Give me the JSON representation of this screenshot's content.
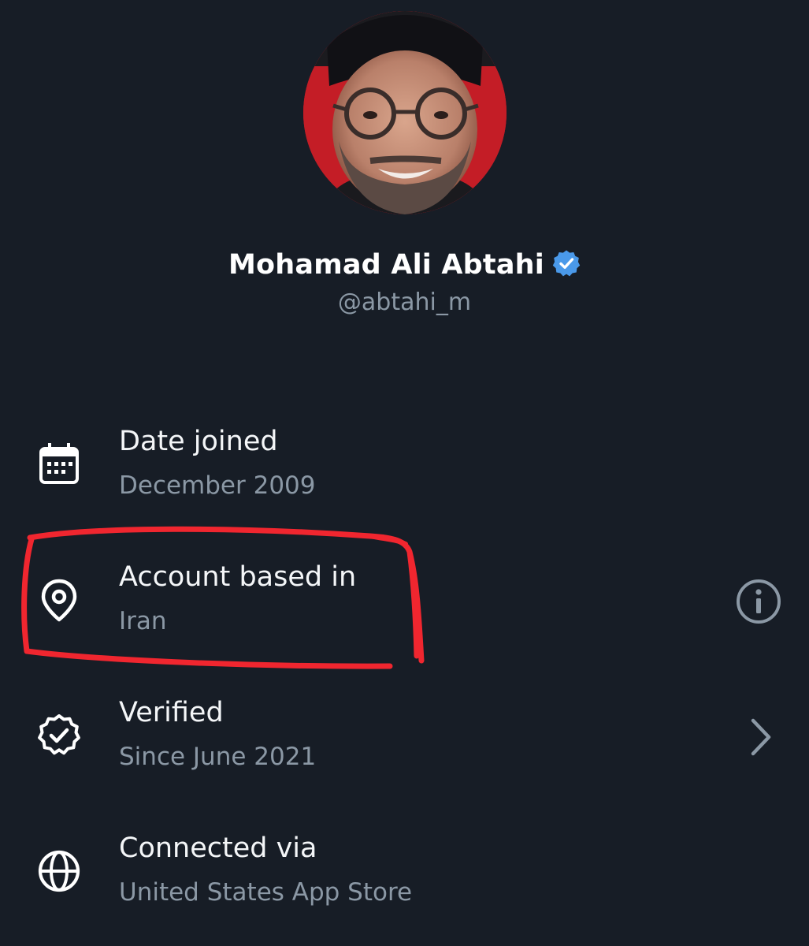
{
  "profile": {
    "display_name": "Mohamad Ali Abtahi",
    "handle": "@abtahi_m",
    "verified_icon": "verified-badge-icon",
    "badge_color": "#4a99e9"
  },
  "about": {
    "rows": [
      {
        "title": "Date joined",
        "value": "December 2009",
        "icon": "calendar-icon",
        "action_icon": ""
      },
      {
        "title": "Account based in",
        "value": "Iran",
        "icon": "location-pin-icon",
        "action_icon": "info-icon"
      },
      {
        "title": "Verified",
        "value": "Since June 2021",
        "icon": "verified-check-icon",
        "action_icon": "chevron-right-icon"
      },
      {
        "title": "Connected via",
        "value": "United States App Store",
        "icon": "globe-icon",
        "action_icon": ""
      }
    ]
  },
  "colors": {
    "background": "#171d26",
    "primary_text": "#f4f6f8",
    "secondary_text": "#8b98a5",
    "annotation": "#f0262f"
  }
}
